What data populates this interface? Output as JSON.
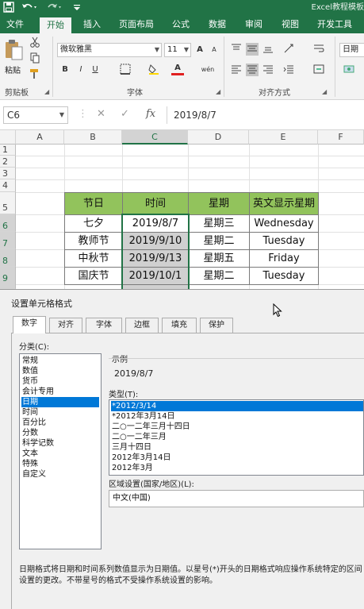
{
  "window": {
    "title": "Excel教程模板",
    "qa_icons": [
      "save-icon",
      "undo-icon",
      "redo-icon",
      "customize-icon"
    ]
  },
  "ribbon_tabs": [
    "文件",
    "开始",
    "插入",
    "页面布局",
    "公式",
    "数据",
    "审阅",
    "视图",
    "开发工具"
  ],
  "ribbon": {
    "clipboard": {
      "paste_label": "粘贴",
      "group_label": "剪贴板"
    },
    "font": {
      "font_name": "微软雅黑",
      "font_size": "11",
      "bold": "B",
      "italic": "I",
      "underline": "U",
      "increase": "A",
      "decrease": "A",
      "color_a": "A",
      "phonetic": "wén",
      "group_label": "字体"
    },
    "alignment": {
      "group_label": "对齐方式"
    },
    "number": {
      "format": "日期"
    }
  },
  "formula_bar": {
    "name_box": "C6",
    "cancel": "✕",
    "enter": "✓",
    "fx": "fx",
    "value": "2019/8/7"
  },
  "grid": {
    "columns": [
      "A",
      "B",
      "C",
      "D",
      "E",
      "F"
    ],
    "rows": [
      "1",
      "2",
      "3",
      "4",
      "5",
      "6",
      "7",
      "8",
      "9"
    ],
    "header": [
      "节日",
      "时间",
      "星期",
      "英文显示星期"
    ],
    "data": [
      [
        "七夕",
        "2019/8/7",
        "星期三",
        "Wednesday"
      ],
      [
        "教师节",
        "2019/9/10",
        "星期二",
        "Tuesday"
      ],
      [
        "中秋节",
        "2019/9/13",
        "星期五",
        "Friday"
      ],
      [
        "国庆节",
        "2019/10/1",
        "星期二",
        "Tuesday"
      ]
    ]
  },
  "dialog": {
    "title": "设置单元格格式",
    "tabs": [
      "数字",
      "对齐",
      "字体",
      "边框",
      "填充",
      "保护"
    ],
    "category_label": "分类(C):",
    "categories": [
      "常规",
      "数值",
      "货币",
      "会计专用",
      "日期",
      "时间",
      "百分比",
      "分数",
      "科学记数",
      "文本",
      "特殊",
      "自定义"
    ],
    "selected_category": "日期",
    "sample_label": "示例",
    "sample_value": "2019/8/7",
    "type_label": "类型(T):",
    "types": [
      "*2012/3/14",
      "*2012年3月14日",
      "二○一二年三月十四日",
      "二○一二年三月",
      "三月十四日",
      "2012年3月14日",
      "2012年3月"
    ],
    "locale_label": "区域设置(国家/地区)(L):",
    "locale_value": "中文(中国)",
    "description": "日期格式将日期和时间系列数值显示为日期值。以星号(*)开头的日期格式响应操作系统特定的区间设置的更改。不带星号的格式不受操作系统设置的影响。"
  }
}
